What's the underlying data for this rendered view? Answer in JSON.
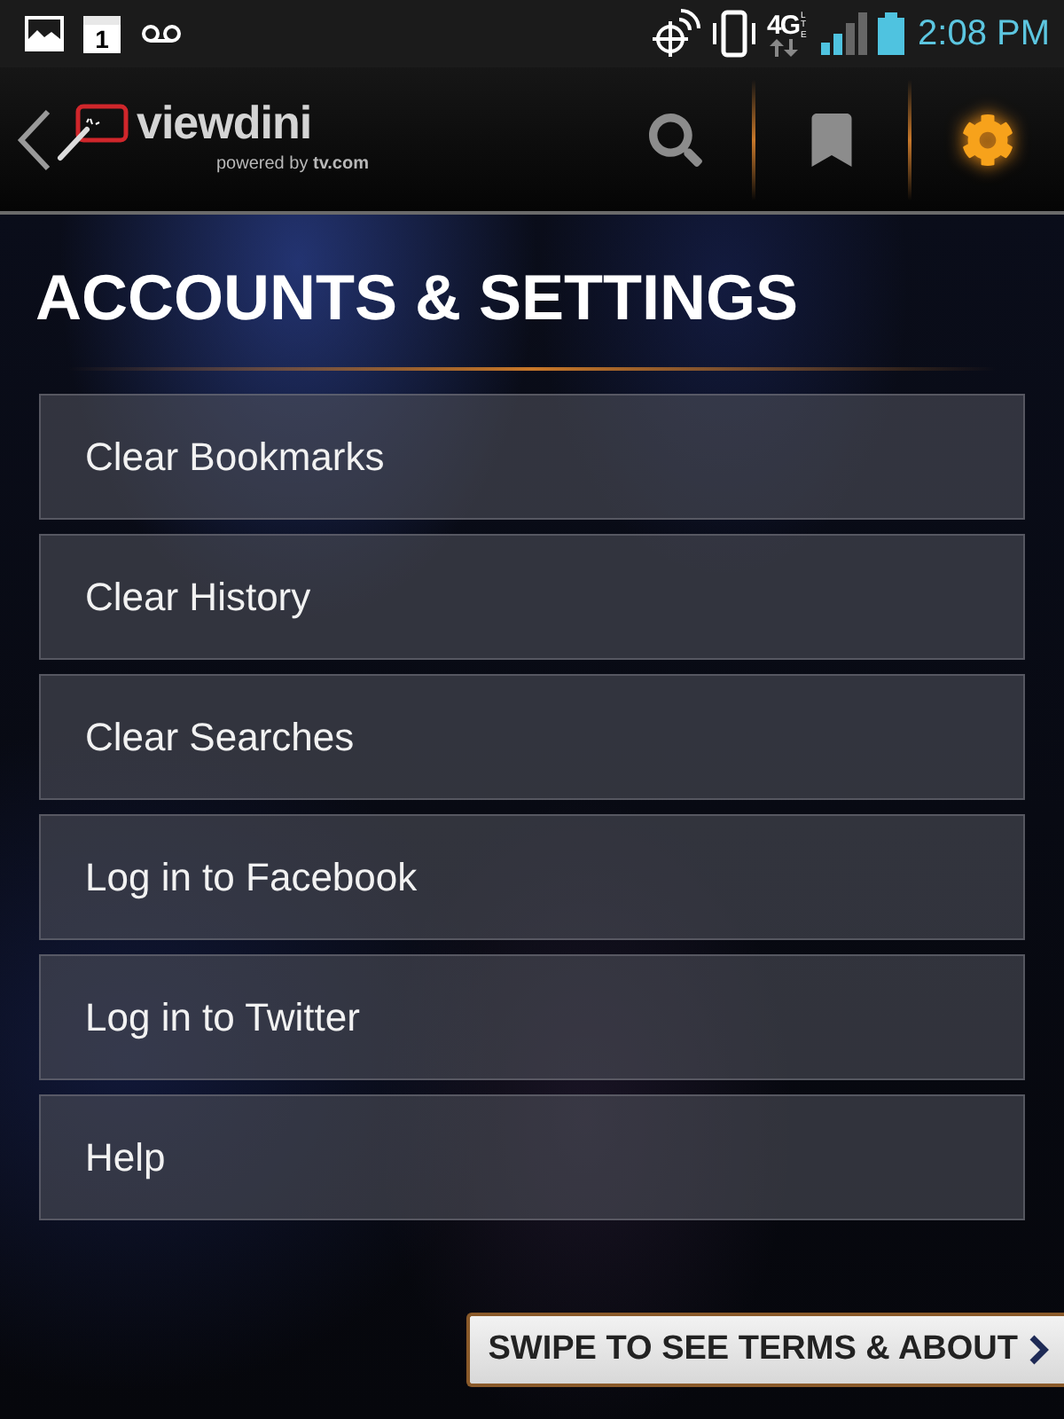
{
  "status_bar": {
    "calendar_day": "1",
    "network": {
      "generation": "4G",
      "sub": "LTE"
    },
    "time": "2:08 PM"
  },
  "app_bar": {
    "logo": {
      "name": "viewdini",
      "tagline": "powered by **tv.com**"
    },
    "actions": [
      {
        "kind": "search",
        "selected": false
      },
      {
        "kind": "bookmark",
        "selected": false
      },
      {
        "kind": "settings",
        "selected": true
      }
    ]
  },
  "page": {
    "title": "ACCOUNTS & SETTINGS",
    "items": [
      {
        "label": "Clear Bookmarks"
      },
      {
        "label": "Clear History"
      },
      {
        "label": "Clear Searches"
      },
      {
        "label": "Log in to Facebook"
      },
      {
        "label": "Log in to Twitter"
      },
      {
        "label": "Help"
      }
    ]
  },
  "swipe_hint": {
    "label": "SWIPE TO SEE TERMS & ABOUT"
  }
}
